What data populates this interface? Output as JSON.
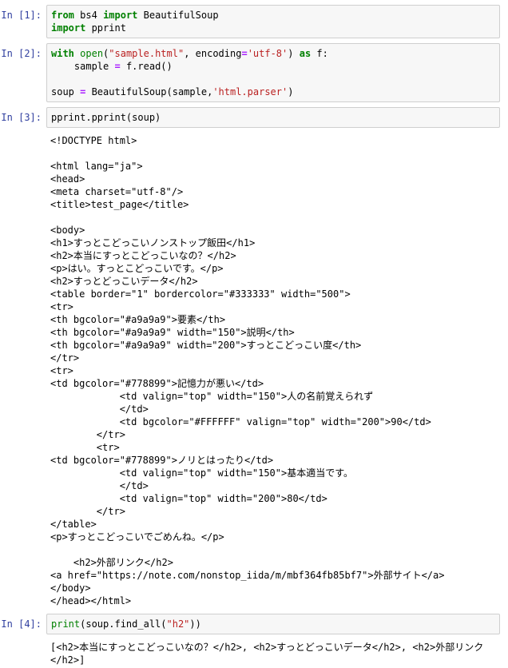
{
  "notebook": {
    "cells": [
      {
        "type": "code",
        "prompt": "In [1]:",
        "source_plain": "from bs4 import BeautifulSoup\nimport pprint",
        "tokens": [
          {
            "t": "from",
            "c": "k"
          },
          {
            "t": " ",
            "c": "n"
          },
          {
            "t": "bs4",
            "c": "n"
          },
          {
            "t": " ",
            "c": "n"
          },
          {
            "t": "import",
            "c": "k"
          },
          {
            "t": " BeautifulSoup\n",
            "c": "n"
          },
          {
            "t": "import",
            "c": "k"
          },
          {
            "t": " pprint",
            "c": "n"
          }
        ]
      },
      {
        "type": "code",
        "prompt": "In [2]:",
        "source_plain": "with open(\"sample.html\", encoding='utf-8') as f:\n    sample = f.read()\n\nsoup = BeautifulSoup(sample,'html.parser')",
        "tokens": [
          {
            "t": "with",
            "c": "k"
          },
          {
            "t": " ",
            "c": "n"
          },
          {
            "t": "open",
            "c": "nb"
          },
          {
            "t": "(",
            "c": "n"
          },
          {
            "t": "\"sample.html\"",
            "c": "s"
          },
          {
            "t": ", encoding",
            "c": "n"
          },
          {
            "t": "=",
            "c": "o"
          },
          {
            "t": "'utf-8'",
            "c": "s"
          },
          {
            "t": ") ",
            "c": "n"
          },
          {
            "t": "as",
            "c": "k"
          },
          {
            "t": " f:\n    sample ",
            "c": "n"
          },
          {
            "t": "=",
            "c": "o"
          },
          {
            "t": " f.read()\n\nsoup ",
            "c": "n"
          },
          {
            "t": "=",
            "c": "o"
          },
          {
            "t": " BeautifulSoup(sample,",
            "c": "n"
          },
          {
            "t": "'html.parser'",
            "c": "s"
          },
          {
            "t": ")",
            "c": "n"
          }
        ]
      },
      {
        "type": "code",
        "prompt": "In [3]:",
        "source_plain": "pprint.pprint(soup)",
        "tokens": [
          {
            "t": "pprint.pprint(soup)",
            "c": "n"
          }
        ],
        "output": "<!DOCTYPE html>\n\n<html lang=\"ja\">\n<head>\n<meta charset=\"utf-8\"/>\n<title>test_page</title>\n\n<body>\n<h1>すっとこどっこいノンストップ飯田</h1>\n<h2>本当にすっとこどっこいなの？</h2>\n<p>はい。すっとこどっこいです。</p>\n<h2>すっとどっこいデータ</h2>\n<table border=\"1\" bordercolor=\"#333333\" width=\"500\">\n<tr>\n<th bgcolor=\"#a9a9a9\">要素</th>\n<th bgcolor=\"#a9a9a9\" width=\"150\">説明</th>\n<th bgcolor=\"#a9a9a9\" width=\"200\">すっとこどっこい度</th>\n</tr>\n<tr>\n<td bgcolor=\"#778899\">記憶力が悪い</td>\n            <td valign=\"top\" width=\"150\">人の名前覚えられず\n            </td>\n            <td bgcolor=\"#FFFFFF\" valign=\"top\" width=\"200\">90</td>\n        </tr>\n        <tr>\n<td bgcolor=\"#778899\">ノリとはったり</td>\n            <td valign=\"top\" width=\"150\">基本適当です。\n            </td>\n            <td valign=\"top\" width=\"200\">80</td>\n        </tr>\n</table>\n<p>すっとこどっこいでごめんね。</p>\n\n    <h2>外部リンク</h2>\n<a href=\"https://note.com/nonstop_iida/m/mbf364fb85bf7\">外部サイト</a>\n</body>\n</head></html>"
      },
      {
        "type": "code",
        "prompt": "In [4]:",
        "source_plain": "print(soup.find_all(\"h2\"))",
        "tokens": [
          {
            "t": "print",
            "c": "nb"
          },
          {
            "t": "(soup.find_all(",
            "c": "n"
          },
          {
            "t": "\"h2\"",
            "c": "s"
          },
          {
            "t": "))",
            "c": "n"
          }
        ],
        "output": "[<h2>本当にすっとこどっこいなの？</h2>, <h2>すっとどっこいデータ</h2>, <h2>外部リンク</h2>]"
      }
    ]
  },
  "colors": {
    "prompt": "#303F9F",
    "keyword": "#008000",
    "builtin": "#008000",
    "string": "#BA2121",
    "operator": "#AA22FF",
    "cell_background": "#f7f7f7",
    "cell_border": "#cfcfcf",
    "text": "#000000"
  }
}
